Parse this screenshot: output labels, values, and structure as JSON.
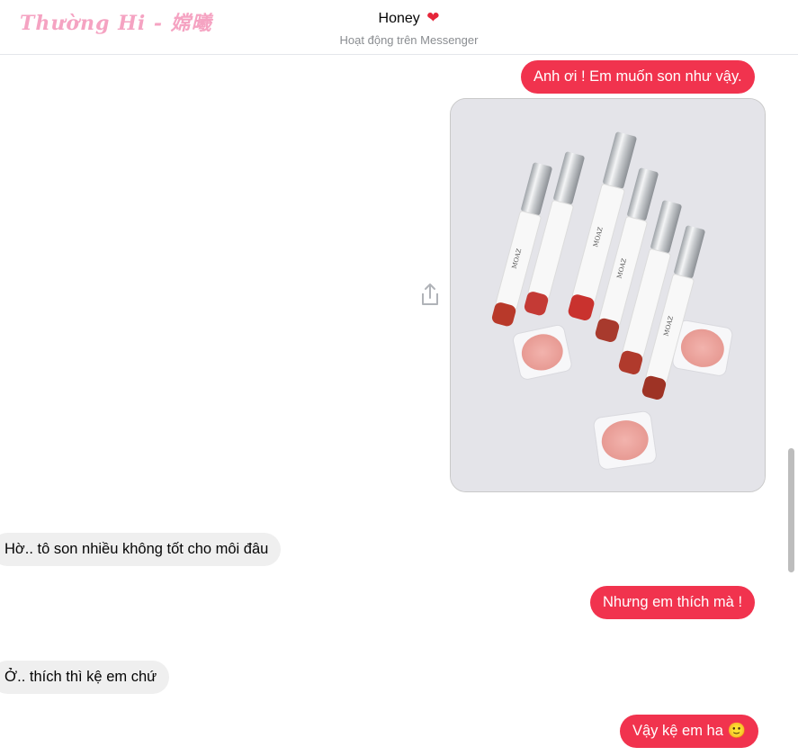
{
  "watermark": "Thường Hi - 嫦曦",
  "header": {
    "name": "Honey",
    "status": "Hoạt động trên Messenger"
  },
  "messages": [
    {
      "from": "me",
      "text": "Anh ơi ! Em muốn son như vậy."
    },
    {
      "from": "me",
      "image": "lipstick-photo"
    },
    {
      "from": "them",
      "text": "Hờ.. tô son nhiều không tốt cho môi đâu"
    },
    {
      "from": "me",
      "text": "Nhưng em thích mà !"
    },
    {
      "from": "them",
      "text": "Ở.. thích thì kệ em chứ"
    },
    {
      "from": "me",
      "text": "Vậy kệ em ha",
      "emoji": "🙂"
    }
  ],
  "image_brand": "MOAZ",
  "colors": {
    "outgoing": "#f1334e",
    "incoming": "#efefef",
    "watermark": "#f5a3c2"
  }
}
